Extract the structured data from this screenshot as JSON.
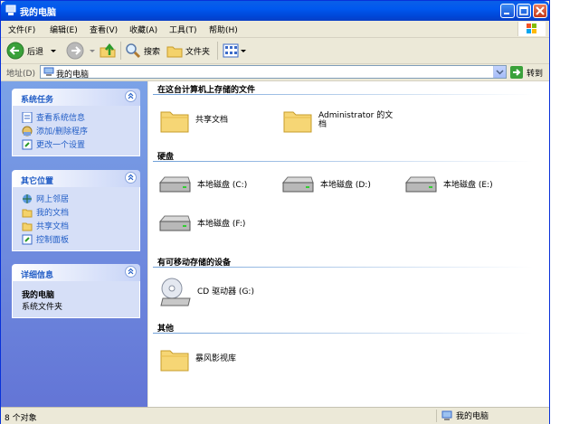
{
  "window": {
    "title": "我的电脑"
  },
  "menu": [
    "文件(F)",
    "编辑(E)",
    "查看(V)",
    "收藏(A)",
    "工具(T)",
    "帮助(H)"
  ],
  "toolbar": {
    "back": "后退",
    "search": "搜索",
    "folders": "文件夹"
  },
  "address": {
    "label": "地址(D)",
    "value": "我的电脑",
    "go": "转到"
  },
  "sidebar": {
    "system_tasks": {
      "title": "系统任务",
      "items": [
        "查看系统信息",
        "添加/删除程序",
        "更改一个设置"
      ]
    },
    "other_places": {
      "title": "其它位置",
      "items": [
        "网上邻居",
        "我的文档",
        "共享文档",
        "控制面板"
      ]
    },
    "details": {
      "title": "详细信息",
      "name": "我的电脑",
      "type": "系统文件夹"
    }
  },
  "sections": {
    "stored": {
      "title": "在这台计算机上存储的文件",
      "items": [
        "共享文档",
        "Administrator 的文档"
      ]
    },
    "hdd": {
      "title": "硬盘",
      "items": [
        "本地磁盘 (C:)",
        "本地磁盘 (D:)",
        "本地磁盘 (E:)",
        "本地磁盘 (F:)"
      ]
    },
    "removable": {
      "title": "有可移动存储的设备",
      "items": [
        "CD 驱动器 (G:)"
      ]
    },
    "other": {
      "title": "其他",
      "items": [
        "暴风影视库"
      ]
    }
  },
  "status": {
    "count": "8 个对象",
    "location": "我的电脑"
  }
}
